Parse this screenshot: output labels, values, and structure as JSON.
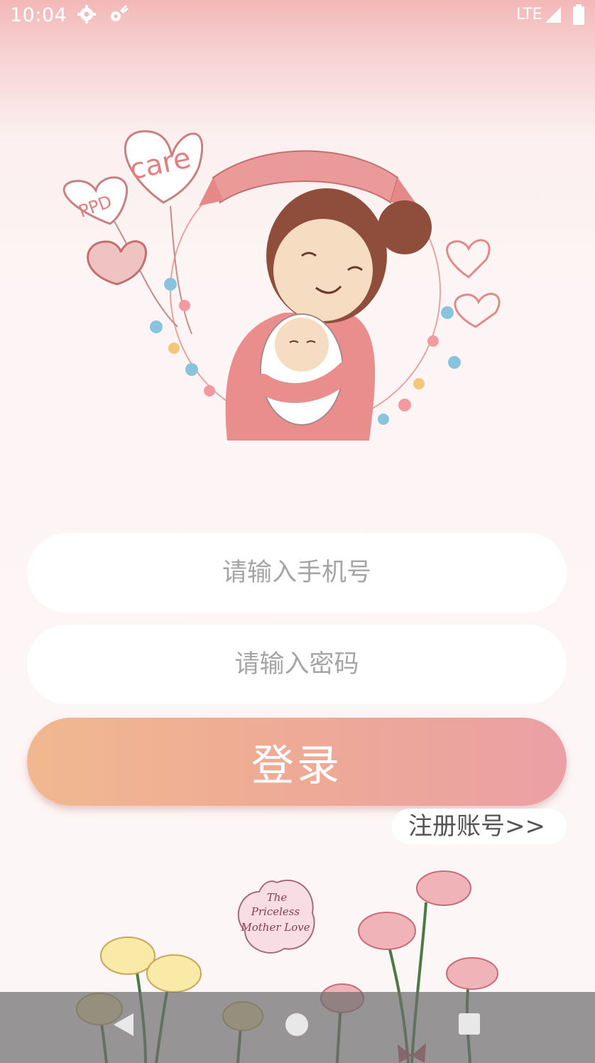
{
  "status": {
    "time": "10:04",
    "network": "LTE",
    "icons": [
      "settings-icon",
      "notification-icon",
      "signal-icon",
      "battery-icon"
    ]
  },
  "hero": {
    "balloon_care": "care",
    "balloon_ppd": "PPD"
  },
  "form": {
    "phone_placeholder": "请输入手机号",
    "password_placeholder": "请输入密码",
    "login_label": "登录",
    "register_label": "注册账号>>"
  },
  "footer": {
    "card_line1": "The",
    "card_line2": "Priceless",
    "card_line3": "Mother Love"
  },
  "nav": {
    "icons": [
      "back-icon",
      "home-icon",
      "recents-icon"
    ]
  },
  "colors": {
    "accent_start": "#f1b890",
    "accent_end": "#eba0a4",
    "status_bg": "#f3b8b8"
  }
}
